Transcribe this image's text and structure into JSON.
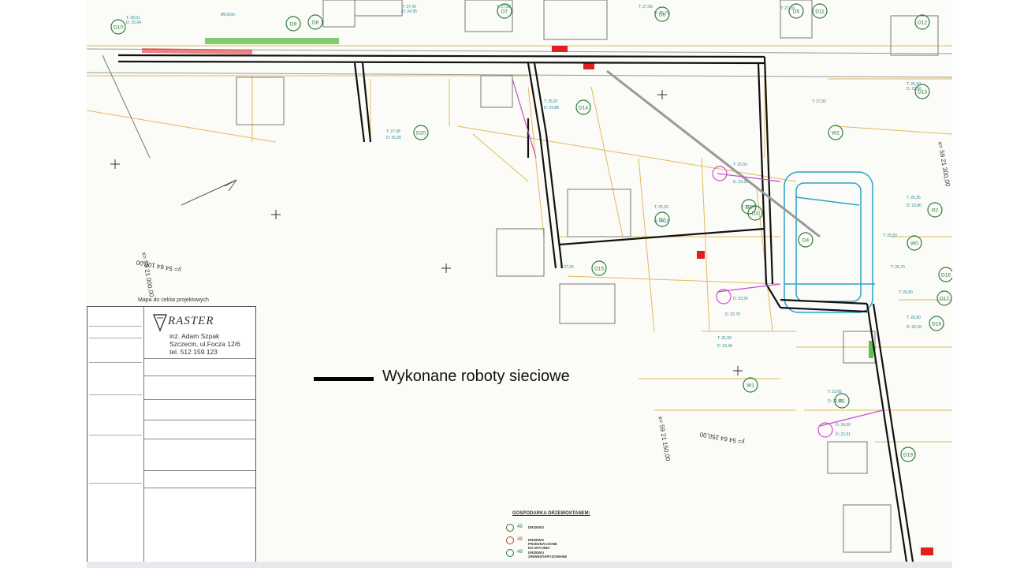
{
  "legend": {
    "work_line_label": "Wykonane roboty sieciowe",
    "work_line_color": "#000000"
  },
  "title_block": {
    "heading": "Mapa do celów projektowych",
    "company": "RASTER",
    "owner": "inż. Adam Szpak",
    "address": "Szczecin, ul.Focza 12/6",
    "phone": "tel. 512 159 123"
  },
  "tree_legend": {
    "title": "GOSPODARKA DRZEWOSTANEM:",
    "items": [
      {
        "num": "49",
        "label": "DRZEWO",
        "color": "#2f7a3a"
      },
      {
        "num": "49",
        "label": "DRZEWO PRZEZNACZONE DO WYCINKI",
        "color": "#c0392b"
      },
      {
        "num": "49",
        "label": "DRZEWO ZINWENTARYZOWANE",
        "color": "#2f7a3a"
      }
    ]
  },
  "tree_labels": [
    "D10",
    "D9",
    "D8",
    "D7",
    "D6",
    "D5",
    "D11",
    "D12",
    "D13",
    "D14",
    "D20",
    "W2",
    "D1",
    "D2",
    "D3",
    "D4",
    "R2",
    "W0",
    "D16",
    "D17",
    "D18",
    "D15",
    "W1",
    "R1",
    "D19"
  ],
  "colors": {
    "network": "#111111",
    "parcel": "#e3b95c",
    "water": "#2aa3c8",
    "tree": "#2f7a3a",
    "designed": "#c74fd0",
    "highlight_red": "#e02020",
    "highlight_green": "#5fc04a"
  }
}
